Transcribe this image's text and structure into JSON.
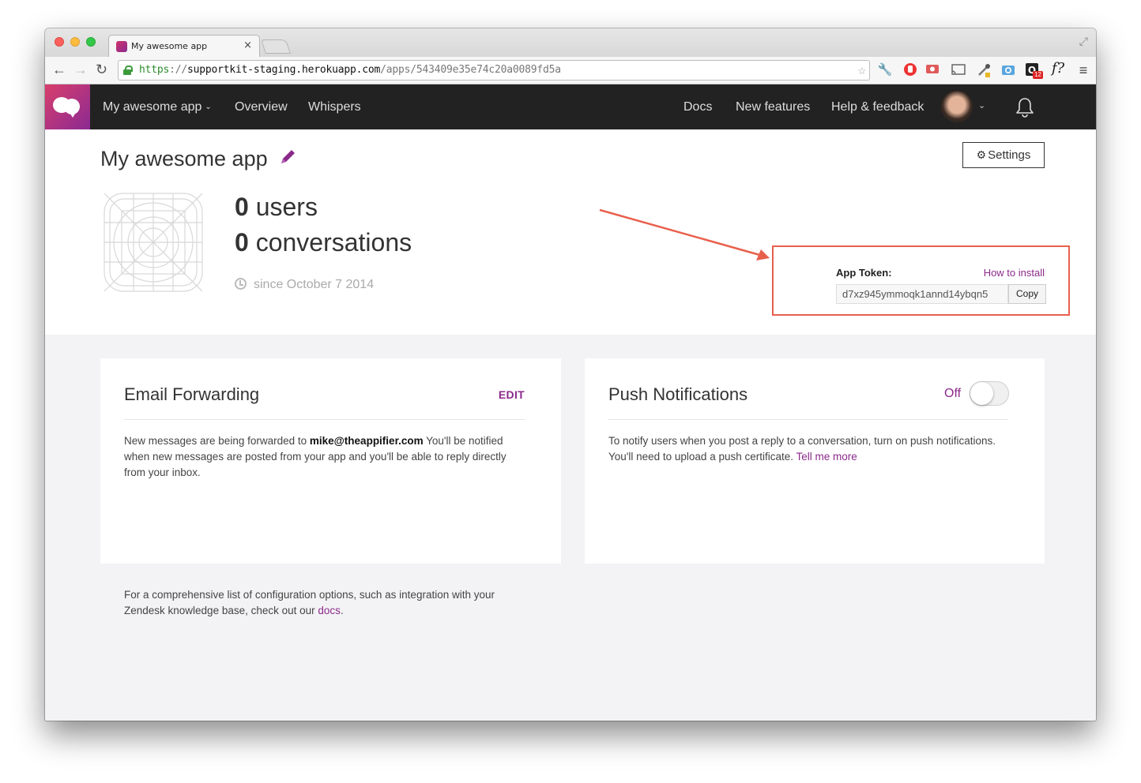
{
  "browser": {
    "tab_title": "My awesome app",
    "tab_close": "×",
    "url_scheme": "https",
    "url_sep": "://",
    "url_host": "supportkit-staging.herokuapp.com",
    "url_path": "/apps/543409e35e74c20a0089fd5a",
    "extension_badge": "12"
  },
  "nav": {
    "app_menu": "My awesome app",
    "overview": "Overview",
    "whispers": "Whispers",
    "docs": "Docs",
    "new_features": "New features",
    "help": "Help & feedback"
  },
  "app": {
    "title": "My awesome app",
    "settings_label": "Settings",
    "users_count": "0",
    "users_label": "users",
    "conversations_count": "0",
    "conversations_label": "conversations",
    "since": "since October 7 2014",
    "token_label": "App Token:",
    "how_to_install": "How to install",
    "token_value": "d7xz945ymmoqk1annd14ybqn5",
    "copy_label": "Copy"
  },
  "email_card": {
    "title": "Email Forwarding",
    "edit_label": "EDIT",
    "text_before": "New messages are being forwarded to ",
    "email": "mike@theappifier.com",
    "text_after": " You'll be notified when new messages are posted from your app and you'll be able to reply directly from your inbox."
  },
  "push_card": {
    "title": "Push Notifications",
    "toggle_label": "Off",
    "toggle_on": false,
    "text": "To notify users when you post a reply to a conversation, turn on push notifications. You'll need to upload a push certificate. ",
    "link": "Tell me more"
  },
  "footer": {
    "text": "For a comprehensive list of configuration options, such as integration with your Zendesk knowledge base, check out our ",
    "link": "docs",
    "end": "."
  },
  "colors": {
    "accent": "#8b2a8a",
    "nav_bg": "#222222",
    "highlight": "#e8604c"
  }
}
